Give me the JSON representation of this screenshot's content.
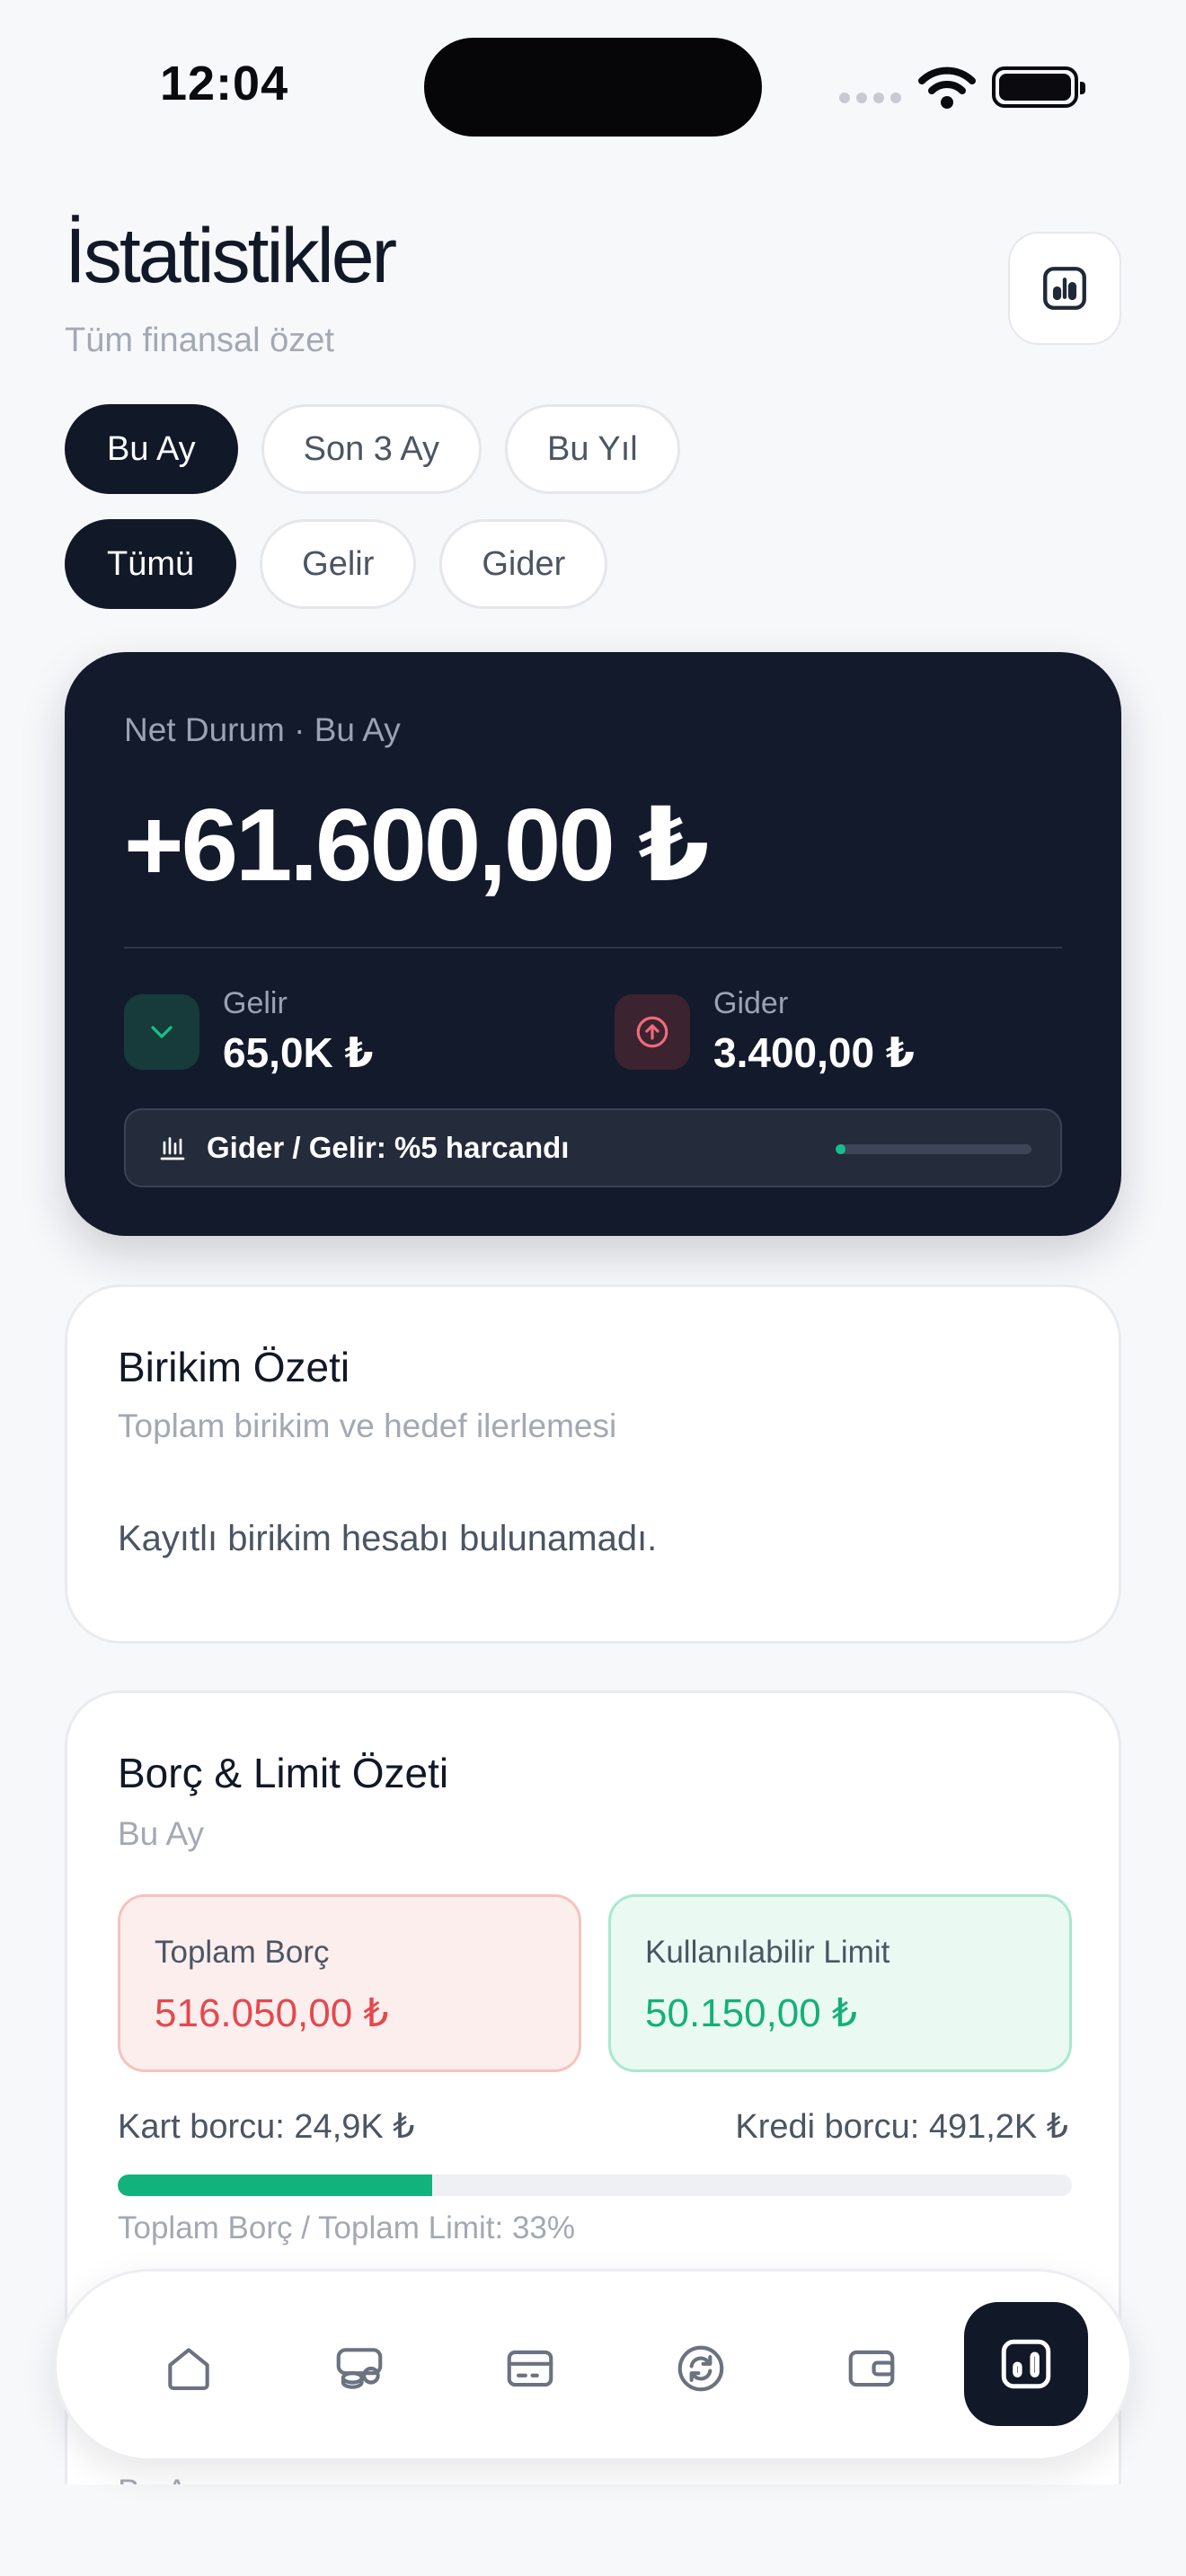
{
  "status_bar": {
    "time": "12:04"
  },
  "header": {
    "title": "İstatistikler",
    "subtitle": "Tüm finansal özet"
  },
  "filters": {
    "period": [
      {
        "label": "Bu Ay",
        "active": true
      },
      {
        "label": "Son 3 Ay",
        "active": false
      },
      {
        "label": "Bu Yıl",
        "active": false
      }
    ],
    "type": [
      {
        "label": "Tümü",
        "active": true
      },
      {
        "label": "Gelir",
        "active": false
      },
      {
        "label": "Gider",
        "active": false
      }
    ]
  },
  "net_card": {
    "label": "Net Durum · Bu Ay",
    "amount": "+61.600,00 ₺",
    "income_label": "Gelir",
    "income_value": "65,0K ₺",
    "expense_label": "Gider",
    "expense_value": "3.400,00 ₺",
    "ratio_text": "Gider / Gelir: %5 harcandı",
    "ratio_percent": 5
  },
  "savings_card": {
    "title": "Birikim Özeti",
    "subtitle": "Toplam birikim ve hedef ilerlemesi",
    "empty_message": "Kayıtlı birikim hesabı bulunamadı."
  },
  "debt_card": {
    "title": "Borç & Limit Özeti",
    "subtitle": "Bu Ay",
    "total_debt_label": "Toplam Borç",
    "total_debt_value": "516.050,00 ₺",
    "available_limit_label": "Kullanılabilir Limit",
    "available_limit_value": "50.150,00 ₺",
    "card_debt": "Kart borcu: 24,9K ₺",
    "loan_debt": "Kredi borcu: 491,2K ₺",
    "ratio_percent": 33,
    "ratio_caption": "Toplam Borç / Toplam Limit: 33%"
  },
  "next_card_peek": {
    "subtitle": "Bu Ay"
  },
  "tabbar": {
    "items": [
      {
        "icon": "home-icon",
        "active": false
      },
      {
        "icon": "coins-icon",
        "active": false
      },
      {
        "icon": "credit-card-icon",
        "active": false
      },
      {
        "icon": "refresh-icon",
        "active": false
      },
      {
        "icon": "wallet-icon",
        "active": false
      },
      {
        "icon": "bar-chart-icon",
        "active": true
      }
    ]
  },
  "colors": {
    "dark": "#111827",
    "net_card_bg": "#131a2b",
    "income_green": "#16c08a",
    "debt_red": "#e5484d",
    "limit_green": "#14b07c"
  }
}
